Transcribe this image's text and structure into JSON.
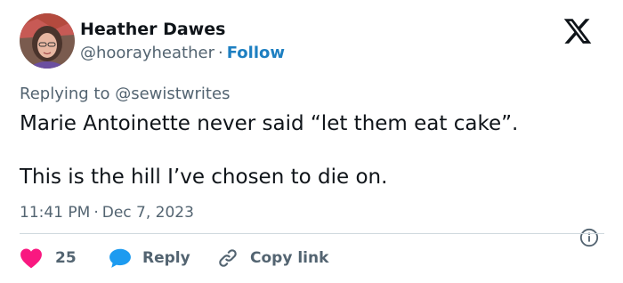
{
  "author": {
    "name": "Heather Dawes",
    "handle": "@hoorayheather",
    "separator": "·",
    "follow_label": "Follow"
  },
  "icons": {
    "logo": "x-logo-icon",
    "info": "info-icon",
    "like": "heart-icon",
    "reply": "speech-bubble-icon",
    "copy": "link-icon"
  },
  "tweet": {
    "replying_to": "Replying to @sewistwrites",
    "lines": [
      "Marie Antoinette never said “let them eat cake”.",
      "This is the hill I’ve chosen to die on."
    ],
    "time": "11:41 PM",
    "separator": "·",
    "date": "Dec 7, 2023"
  },
  "actions": {
    "likes_count": "25",
    "reply_label": "Reply",
    "copy_label": "Copy link"
  },
  "colors": {
    "like": "#f91880",
    "reply": "#1d9bf0",
    "follow": "#1d7fc1",
    "muted": "#536471",
    "text": "#0f1419"
  }
}
